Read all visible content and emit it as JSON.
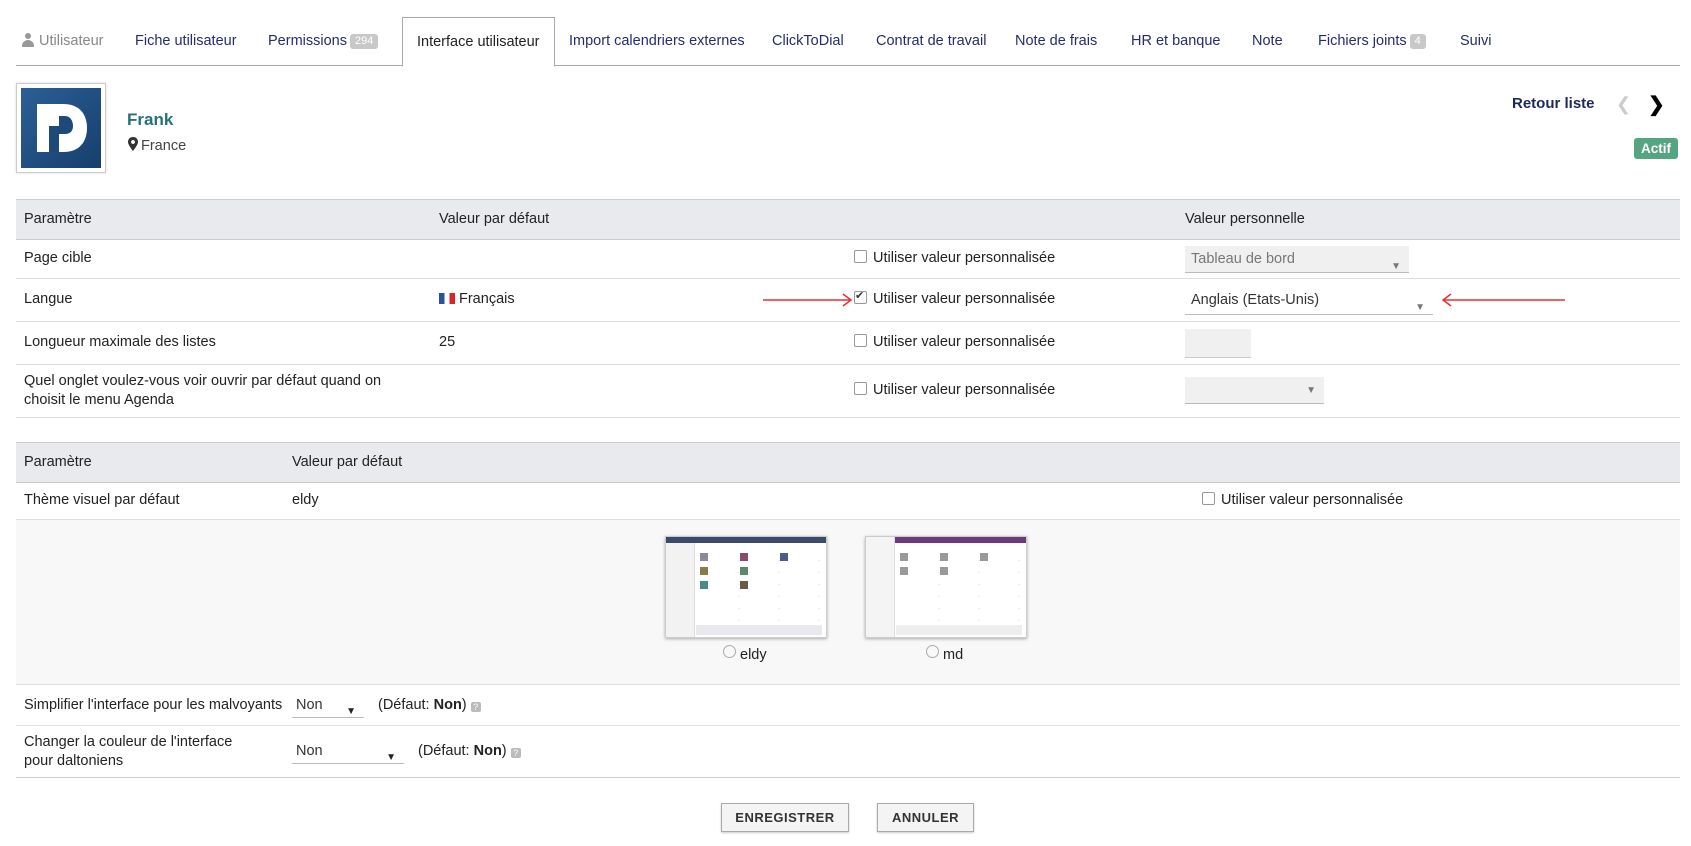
{
  "tabs": [
    {
      "label": "Utilisateur"
    },
    {
      "label": "Fiche utilisateur"
    },
    {
      "label": "Permissions",
      "badge": "294"
    },
    {
      "label": "Interface utilisateur"
    },
    {
      "label": "Import calendriers externes"
    },
    {
      "label": "ClickToDial"
    },
    {
      "label": "Contrat de travail"
    },
    {
      "label": "Note de frais"
    },
    {
      "label": "HR et banque"
    },
    {
      "label": "Note"
    },
    {
      "label": "Fichiers joints",
      "badge": "4"
    },
    {
      "label": "Suivi"
    }
  ],
  "user": {
    "name": "Frank",
    "location": "France",
    "status": "Actif"
  },
  "nav": {
    "back_label": "Retour liste",
    "prev_icon": "chevron-left-icon",
    "next_icon": "chevron-right-icon"
  },
  "table1": {
    "headers": {
      "param": "Paramètre",
      "default": "Valeur par défaut",
      "personal": "Valeur personnelle"
    },
    "custom_label": "Utiliser valeur personnalisée",
    "rows": [
      {
        "param": "Page cible",
        "default": "",
        "checked": false,
        "personal": "Tableau de bord"
      },
      {
        "param": "Langue",
        "default": "Français",
        "checked": true,
        "personal": "Anglais (Etats-Unis)"
      },
      {
        "param": "Longueur maximale des listes",
        "default": "25",
        "checked": false,
        "personal": ""
      },
      {
        "param": "Quel onglet voulez-vous voir ouvrir par défaut quand on choisit le menu Agenda",
        "default": "",
        "checked": false,
        "personal": ""
      }
    ]
  },
  "table2": {
    "headers": {
      "param": "Paramètre",
      "default": "Valeur par défaut"
    },
    "theme_row": {
      "param": "Thème visuel par défaut",
      "default": "eldy",
      "custom_label": "Utiliser valeur personnalisée"
    },
    "themes": [
      {
        "label": "eldy"
      },
      {
        "label": "md"
      }
    ],
    "low_vision": {
      "param": "Simplifier l'interface pour les malvoyants",
      "value": "Non",
      "default_prefix": "(Défaut: ",
      "default_value": "Non",
      "default_suffix": ")"
    },
    "color_blind": {
      "param": "Changer la couleur de l'interface pour daltoniens",
      "value": "Non",
      "default_prefix": "(Défaut: ",
      "default_value": "Non",
      "default_suffix": ")"
    }
  },
  "buttons": {
    "save": "ENREGISTRER",
    "cancel": "ANNULER"
  },
  "colors": {
    "accent": "#26727b",
    "nav": "#232d6e",
    "status": "#55a580",
    "arrow": "#e53030"
  }
}
